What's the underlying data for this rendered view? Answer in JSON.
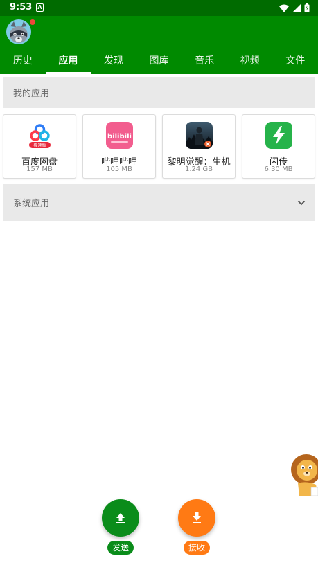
{
  "status": {
    "time": "9:53",
    "notification_letter": "A"
  },
  "tabs": [
    {
      "label": "历史"
    },
    {
      "label": "应用"
    },
    {
      "label": "发现"
    },
    {
      "label": "图库"
    },
    {
      "label": "音乐"
    },
    {
      "label": "视频"
    },
    {
      "label": "文件"
    }
  ],
  "active_tab_index": 1,
  "sections": {
    "mine": "我的应用",
    "system": "系统应用"
  },
  "apps": [
    {
      "name": "百度网盘",
      "size": "157 MB",
      "icon": "baidu-netdisk-icon"
    },
    {
      "name": "哔哩哔哩",
      "size": "105 MB",
      "icon": "bilibili-icon"
    },
    {
      "name": "黎明觉醒：生机",
      "size": "1.24 GB",
      "icon": "game-icon"
    },
    {
      "name": "闪传",
      "size": "6.30 MB",
      "icon": "flash-transfer-icon"
    }
  ],
  "actions": {
    "send_label": "发送",
    "receive_label": "接收"
  },
  "icon_texts": {
    "baidu_badge": "极速版",
    "bilibili_logo": "bilibili"
  },
  "colors": {
    "header": "#008a00",
    "status_bar": "#006b00",
    "send": "#0a8c1a",
    "receive": "#ff7a14",
    "section_bg": "#e9e9e9"
  }
}
